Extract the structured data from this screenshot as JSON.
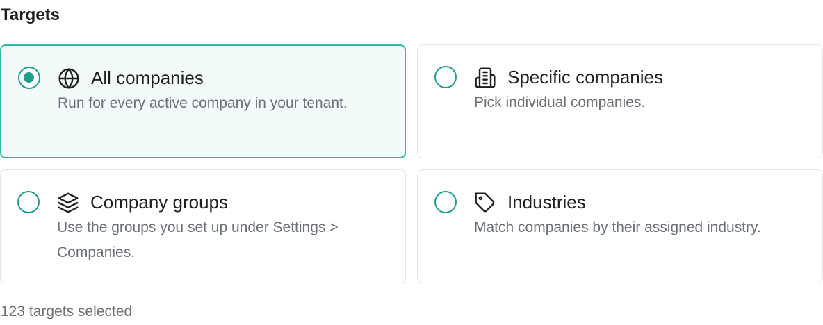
{
  "section": {
    "title": "Targets"
  },
  "options": [
    {
      "title": "All companies",
      "description": "Run for every active company in your tenant.",
      "icon": "globe-icon",
      "selected": true
    },
    {
      "title": "Specific companies",
      "description": "Pick individual companies.",
      "icon": "building-icon",
      "selected": false
    },
    {
      "title": "Company groups",
      "description": "Use the groups you set up under Settings > Companies.",
      "icon": "layers-icon",
      "selected": false
    },
    {
      "title": "Industries",
      "description": "Match companies by their assigned industry.",
      "icon": "tag-icon",
      "selected": false
    }
  ],
  "footer": {
    "status": "123 targets selected"
  },
  "colors": {
    "accent": "#1f9e8e",
    "selected_border": "#2eb8a6",
    "selected_bg": "#f3fbfa"
  }
}
